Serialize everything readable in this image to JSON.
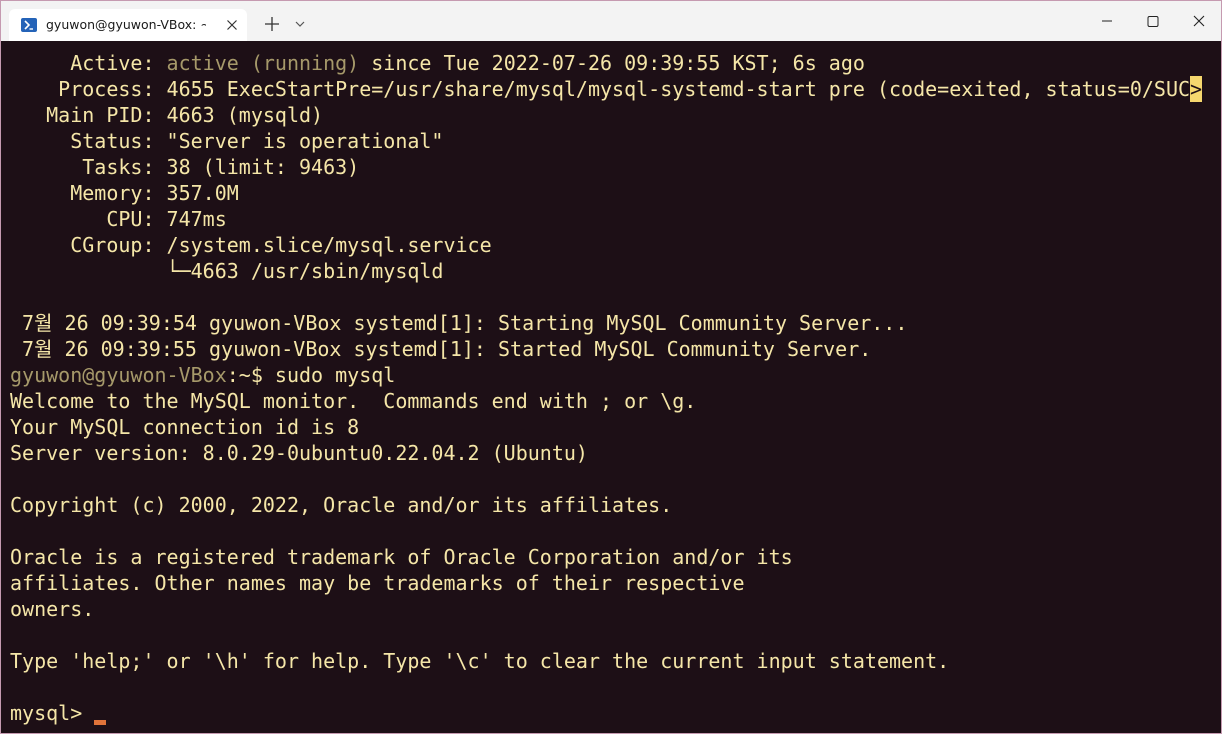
{
  "window": {
    "tab_title": "gyuwon@gyuwon-VBox: ~",
    "tab_icon": "powershell-icon",
    "new_tab_icon": "plus-icon",
    "dropdown_icon": "chevron-down-icon",
    "min_icon": "minimize-icon",
    "max_icon": "maximize-icon",
    "close_icon": "close-icon"
  },
  "colors": {
    "terminal_bg": "#1d0f16",
    "terminal_fg": "#f5e6a8",
    "dim_fg": "#a6996a",
    "caret": "#e0733a"
  },
  "terminal": {
    "status": {
      "active_label": "     Active: ",
      "active_state": "active (running)",
      "active_rest": " since Tue 2022-07-26 09:39:55 KST; 6s ago",
      "process": "    Process: 4655 ExecStartPre=/usr/share/mysql/mysql-systemd-start pre (code=exited, status=0/SUC",
      "process_more": ">",
      "main_pid": "   Main PID: 4663 (mysqld)",
      "status_line": "     Status: \"Server is operational\"",
      "tasks": "      Tasks: 38 (limit: 9463)",
      "memory": "     Memory: 357.0M",
      "cpu": "        CPU: 747ms",
      "cgroup": "     CGroup: /system.slice/mysql.service",
      "cgroup_child": "             └─4663 /usr/sbin/mysqld"
    },
    "log": [
      " 7월 26 09:39:54 gyuwon-VBox systemd[1]: Starting MySQL Community Server...",
      " 7월 26 09:39:55 gyuwon-VBox systemd[1]: Started MySQL Community Server."
    ],
    "prompt": {
      "user_host": "gyuwon@gyuwon-VBox",
      "path": ":~$",
      "command": " sudo mysql"
    },
    "welcome": [
      "Welcome to the MySQL monitor.  Commands end with ; or \\g.",
      "Your MySQL connection id is 8",
      "Server version: 8.0.29-0ubuntu0.22.04.2 (Ubuntu)",
      "",
      "Copyright (c) 2000, 2022, Oracle and/or its affiliates.",
      "",
      "Oracle is a registered trademark of Oracle Corporation and/or its",
      "affiliates. Other names may be trademarks of their respective",
      "owners.",
      "",
      "Type 'help;' or '\\h' for help. Type '\\c' to clear the current input statement.",
      ""
    ],
    "mysql_prompt": "mysql> "
  }
}
